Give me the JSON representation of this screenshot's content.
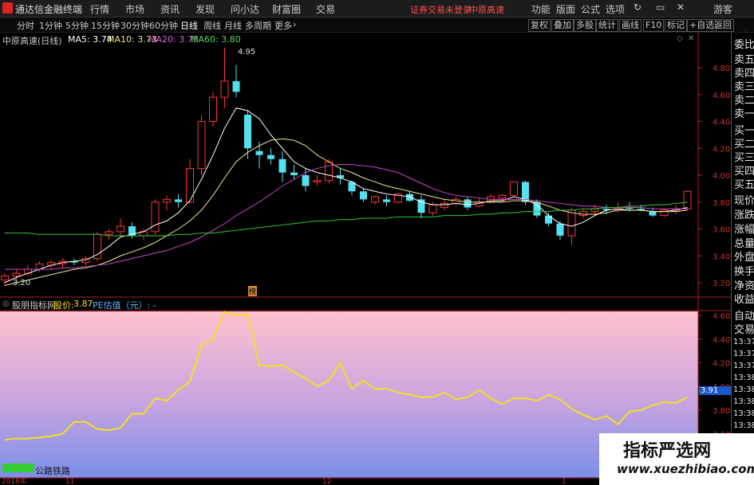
{
  "menubar": {
    "app_title": "通达信金融终端",
    "items": [
      "行情",
      "市场",
      "资讯",
      "发现",
      "问小达",
      "财富圈",
      "交易"
    ],
    "status": "证券交易未登录",
    "stock": "中原高速",
    "right_items": [
      "功能",
      "版面",
      "公式",
      "选项"
    ],
    "guest": "游客"
  },
  "timeframes": [
    "分时",
    "1分钟",
    "5分钟",
    "15分钟",
    "30分钟",
    "60分钟",
    "日线",
    "周线",
    "月线",
    "多周期",
    "更多"
  ],
  "selected_timeframe": "日线",
  "toolbar_right": [
    "复权",
    "叠加",
    "多股",
    "统计",
    "画线",
    "F10",
    "标记",
    "+自选",
    "返回"
  ],
  "main_chart": {
    "stock_label": "中原高速(日线)",
    "ma5": "MA5: 3.74",
    "ma10": "MA10: 3.73",
    "ma20": "MA20: 3.75",
    "ma60": "MA60: 3.80",
    "high_label": "4.95",
    "low_label": "3.20",
    "yticks": [
      "4.80",
      "4.60",
      "4.40",
      "4.20",
      "4.00",
      "3.80",
      "3.60",
      "3.40",
      "3.20"
    ],
    "badge": "榜",
    "up_color": "#ff3333",
    "down_color": "#55e0f0",
    "ma_colors": {
      "ma5": "#ffffff",
      "ma10": "#f0e68c",
      "ma20": "#cc44cc",
      "ma60": "#33cc33"
    }
  },
  "sub_chart": {
    "title": "股朋指标网",
    "price_label": "股价:",
    "price_value": "3.87",
    "pe_label": "PE估值（元）: -",
    "yticks": [
      "4.60",
      "4.40",
      "4.20",
      "4.00",
      "3.80",
      "3.60"
    ],
    "current": "3.91",
    "bottom_text": "公路铁路",
    "x_labels": [
      "2018年",
      "11",
      "12",
      "1"
    ]
  },
  "chart_data": [
    {
      "type": "candlestick",
      "x_range": [
        "2018-10",
        "2019-01"
      ],
      "ylim": [
        3.15,
        5.0
      ],
      "series": [
        {
          "name": "K",
          "ohlc": [
            [
              3.22,
              3.27,
              3.18,
              3.25
            ],
            [
              3.25,
              3.3,
              3.22,
              3.27
            ],
            [
              3.27,
              3.33,
              3.25,
              3.3
            ],
            [
              3.3,
              3.36,
              3.28,
              3.34
            ],
            [
              3.33,
              3.37,
              3.3,
              3.35
            ],
            [
              3.34,
              3.38,
              3.31,
              3.36
            ],
            [
              3.36,
              3.38,
              3.33,
              3.35
            ],
            [
              3.35,
              3.4,
              3.33,
              3.38
            ],
            [
              3.38,
              3.58,
              3.36,
              3.56
            ],
            [
              3.56,
              3.6,
              3.52,
              3.58
            ],
            [
              3.58,
              3.68,
              3.55,
              3.62
            ],
            [
              3.62,
              3.65,
              3.53,
              3.55
            ],
            [
              3.55,
              3.6,
              3.52,
              3.58
            ],
            [
              3.58,
              3.82,
              3.56,
              3.8
            ],
            [
              3.8,
              3.85,
              3.74,
              3.82
            ],
            [
              3.82,
              3.86,
              3.76,
              3.8
            ],
            [
              3.8,
              4.12,
              3.79,
              4.05
            ],
            [
              4.05,
              4.45,
              4.0,
              4.4
            ],
            [
              4.4,
              4.62,
              4.36,
              4.58
            ],
            [
              4.58,
              4.95,
              4.5,
              4.7
            ],
            [
              4.7,
              4.82,
              4.58,
              4.62
            ],
            [
              4.45,
              4.48,
              4.12,
              4.2
            ],
            [
              4.18,
              4.25,
              4.05,
              4.15
            ],
            [
              4.15,
              4.2,
              4.08,
              4.12
            ],
            [
              4.12,
              4.18,
              3.95,
              4.02
            ],
            [
              4.02,
              4.08,
              3.97,
              4.0
            ],
            [
              4.0,
              4.05,
              3.88,
              3.92
            ],
            [
              3.95,
              4.0,
              3.92,
              3.96
            ],
            [
              3.96,
              4.12,
              3.94,
              4.1
            ],
            [
              4.0,
              4.05,
              3.93,
              3.98
            ],
            [
              3.95,
              3.96,
              3.85,
              3.88
            ],
            [
              3.88,
              3.9,
              3.8,
              3.82
            ],
            [
              3.8,
              3.85,
              3.78,
              3.84
            ],
            [
              3.82,
              3.85,
              3.77,
              3.8
            ],
            [
              3.8,
              3.87,
              3.79,
              3.86
            ],
            [
              3.86,
              3.88,
              3.8,
              3.81
            ],
            [
              3.82,
              3.85,
              3.68,
              3.72
            ],
            [
              3.72,
              3.8,
              3.7,
              3.78
            ],
            [
              3.76,
              3.82,
              3.74,
              3.79
            ],
            [
              3.79,
              3.84,
              3.77,
              3.82
            ],
            [
              3.82,
              3.84,
              3.74,
              3.76
            ],
            [
              3.77,
              3.83,
              3.76,
              3.8
            ],
            [
              3.8,
              3.86,
              3.79,
              3.84
            ],
            [
              3.83,
              3.86,
              3.81,
              3.85
            ],
            [
              3.85,
              3.95,
              3.84,
              3.95
            ],
            [
              3.95,
              3.96,
              3.78,
              3.8
            ],
            [
              3.8,
              3.82,
              3.68,
              3.7
            ],
            [
              3.7,
              3.72,
              3.62,
              3.64
            ],
            [
              3.64,
              3.66,
              3.52,
              3.55
            ],
            [
              3.55,
              3.76,
              3.48,
              3.74
            ],
            [
              3.7,
              3.75,
              3.68,
              3.73
            ],
            [
              3.73,
              3.78,
              3.7,
              3.75
            ],
            [
              3.75,
              3.78,
              3.71,
              3.74
            ],
            [
              3.74,
              3.8,
              3.72,
              3.76
            ],
            [
              3.76,
              3.8,
              3.73,
              3.75
            ],
            [
              3.75,
              3.78,
              3.73,
              3.74
            ],
            [
              3.73,
              3.76,
              3.69,
              3.7
            ],
            [
              3.7,
              3.75,
              3.69,
              3.74
            ],
            [
              3.73,
              3.78,
              3.71,
              3.75
            ],
            [
              3.75,
              3.86,
              3.74,
              3.88
            ]
          ]
        },
        {
          "name": "MA5",
          "values": [
            3.2,
            3.24,
            3.27,
            3.3,
            3.33,
            3.35,
            3.36,
            3.37,
            3.41,
            3.47,
            3.54,
            3.56,
            3.58,
            3.63,
            3.66,
            3.72,
            3.81,
            3.97,
            4.15,
            4.35,
            4.5,
            4.48,
            4.42,
            4.3,
            4.2,
            4.1,
            4.05,
            4.02,
            4.0,
            3.98,
            3.95,
            3.9,
            3.88,
            3.86,
            3.85,
            3.84,
            3.8,
            3.78,
            3.78,
            3.79,
            3.78,
            3.79,
            3.81,
            3.81,
            3.84,
            3.82,
            3.78,
            3.7,
            3.64,
            3.62,
            3.65,
            3.7,
            3.74,
            3.75,
            3.74,
            3.74,
            3.73,
            3.73,
            3.74,
            3.76
          ]
        },
        {
          "name": "MA10",
          "values": [
            3.18,
            3.2,
            3.22,
            3.24,
            3.26,
            3.28,
            3.3,
            3.31,
            3.33,
            3.36,
            3.4,
            3.43,
            3.46,
            3.5,
            3.55,
            3.6,
            3.66,
            3.74,
            3.85,
            3.98,
            4.1,
            4.17,
            4.22,
            4.26,
            4.27,
            4.26,
            4.22,
            4.15,
            4.1,
            4.05,
            4.02,
            3.98,
            3.95,
            3.92,
            3.9,
            3.88,
            3.86,
            3.84,
            3.82,
            3.81,
            3.8,
            3.8,
            3.8,
            3.8,
            3.81,
            3.81,
            3.8,
            3.77,
            3.74,
            3.72,
            3.71,
            3.71,
            3.72,
            3.74,
            3.74,
            3.74,
            3.73,
            3.73,
            3.73,
            3.74
          ]
        },
        {
          "name": "MA20",
          "values": [
            3.3,
            3.3,
            3.3,
            3.3,
            3.3,
            3.31,
            3.31,
            3.32,
            3.33,
            3.34,
            3.36,
            3.38,
            3.4,
            3.42,
            3.44,
            3.47,
            3.5,
            3.54,
            3.59,
            3.64,
            3.7,
            3.75,
            3.8,
            3.86,
            3.92,
            3.97,
            4.02,
            4.05,
            4.07,
            4.08,
            4.08,
            4.07,
            4.06,
            4.04,
            4.02,
            3.98,
            3.94,
            3.9,
            3.87,
            3.85,
            3.84,
            3.83,
            3.82,
            3.82,
            3.82,
            3.82,
            3.81,
            3.8,
            3.79,
            3.78,
            3.77,
            3.77,
            3.76,
            3.76,
            3.76,
            3.76,
            3.75,
            3.75,
            3.75,
            3.75
          ]
        },
        {
          "name": "MA60",
          "values": [
            3.57,
            3.57,
            3.57,
            3.56,
            3.56,
            3.56,
            3.56,
            3.56,
            3.56,
            3.55,
            3.55,
            3.55,
            3.55,
            3.55,
            3.55,
            3.56,
            3.56,
            3.57,
            3.57,
            3.58,
            3.59,
            3.6,
            3.61,
            3.62,
            3.63,
            3.64,
            3.65,
            3.66,
            3.66,
            3.67,
            3.67,
            3.68,
            3.68,
            3.68,
            3.69,
            3.69,
            3.69,
            3.69,
            3.7,
            3.7,
            3.7,
            3.71,
            3.71,
            3.72,
            3.72,
            3.73,
            3.73,
            3.73,
            3.74,
            3.74,
            3.75,
            3.75,
            3.76,
            3.76,
            3.77,
            3.77,
            3.78,
            3.78,
            3.79,
            3.8
          ]
        }
      ]
    },
    {
      "type": "area",
      "ylim": [
        3.55,
        4.65
      ],
      "series": [
        {
          "name": "股价",
          "values": [
            3.55,
            3.56,
            3.56,
            3.57,
            3.58,
            3.6,
            3.7,
            3.7,
            3.64,
            3.63,
            3.65,
            3.77,
            3.77,
            3.9,
            3.88,
            3.97,
            4.04,
            4.35,
            4.4,
            4.63,
            4.6,
            4.61,
            4.18,
            4.17,
            4.18,
            4.12,
            4.07,
            4.0,
            4.05,
            4.2,
            3.98,
            4.05,
            3.98,
            3.98,
            3.95,
            3.93,
            3.91,
            3.91,
            3.95,
            3.89,
            3.91,
            3.97,
            3.9,
            3.85,
            3.9,
            3.9,
            3.88,
            3.93,
            3.89,
            3.81,
            3.76,
            3.72,
            3.75,
            3.68,
            3.79,
            3.8,
            3.84,
            3.87,
            3.86,
            3.91
          ]
        }
      ]
    }
  ]
}
